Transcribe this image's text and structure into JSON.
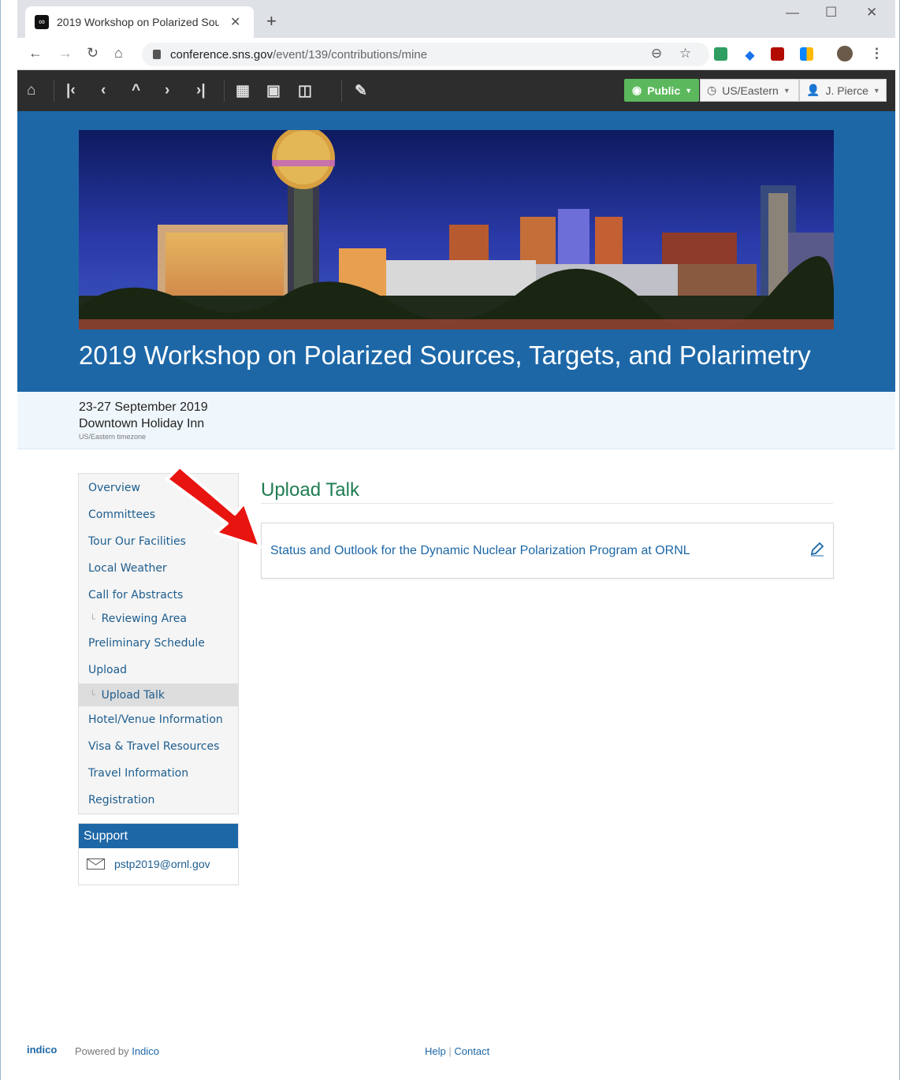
{
  "browser": {
    "tab_title": "2019 Workshop on Polarized Sou",
    "new_tab": "+",
    "close": "✕",
    "url_host": "conference.sns.gov",
    "url_path": "/event/139/contributions/mine",
    "window_controls": [
      "—",
      "☐",
      "✕"
    ]
  },
  "toolbar": {
    "public_label": "Public",
    "timezone_label": "US/Eastern",
    "user_label": "J. Pierce"
  },
  "event": {
    "title": "2019 Workshop on Polarized Sources, Targets, and Polarimetry",
    "dates": "23-27 September 2019",
    "venue": "Downtown Holiday Inn",
    "timezone_note": "US/Eastern timezone"
  },
  "menu": {
    "items": [
      {
        "label": "Overview"
      },
      {
        "label": "Committees"
      },
      {
        "label": "Tour Our Facilities"
      },
      {
        "label": "Local Weather"
      },
      {
        "label": "Call for Abstracts"
      },
      {
        "label": "Reviewing Area",
        "sub": true
      },
      {
        "label": "Preliminary Schedule"
      },
      {
        "label": "Upload"
      },
      {
        "label": "Upload Talk",
        "sub": true,
        "active": true
      },
      {
        "label": "Hotel/Venue Information"
      },
      {
        "label": "Visa & Travel Resources"
      },
      {
        "label": "Travel Information"
      },
      {
        "label": "Registration"
      }
    ]
  },
  "support": {
    "heading": "Support",
    "email": "pstp2019@ornl.gov"
  },
  "main": {
    "page_title": "Upload Talk",
    "contribution": "Status and Outlook for the Dynamic Nuclear Polarization Program at ORNL"
  },
  "footer": {
    "logo": "indico",
    "powered_by": "Powered by",
    "indico_link": "Indico",
    "help": "Help",
    "separator": "|",
    "contact": "Contact"
  },
  "colors": {
    "header_blue": "#1d67a7",
    "title_green": "#1f7d52",
    "public_green": "#5cb85c",
    "toolbar_dark": "#2d2d2d",
    "arrow_red": "#e8140f"
  },
  "icons": [
    "home-icon",
    "first-icon",
    "prev-icon",
    "up-icon",
    "next-icon",
    "last-icon",
    "calendar-icon",
    "archive-icon",
    "layout-icon",
    "pencil-icon",
    "globe-icon",
    "clock-icon",
    "user-icon",
    "envelope-icon",
    "edit-icon"
  ]
}
